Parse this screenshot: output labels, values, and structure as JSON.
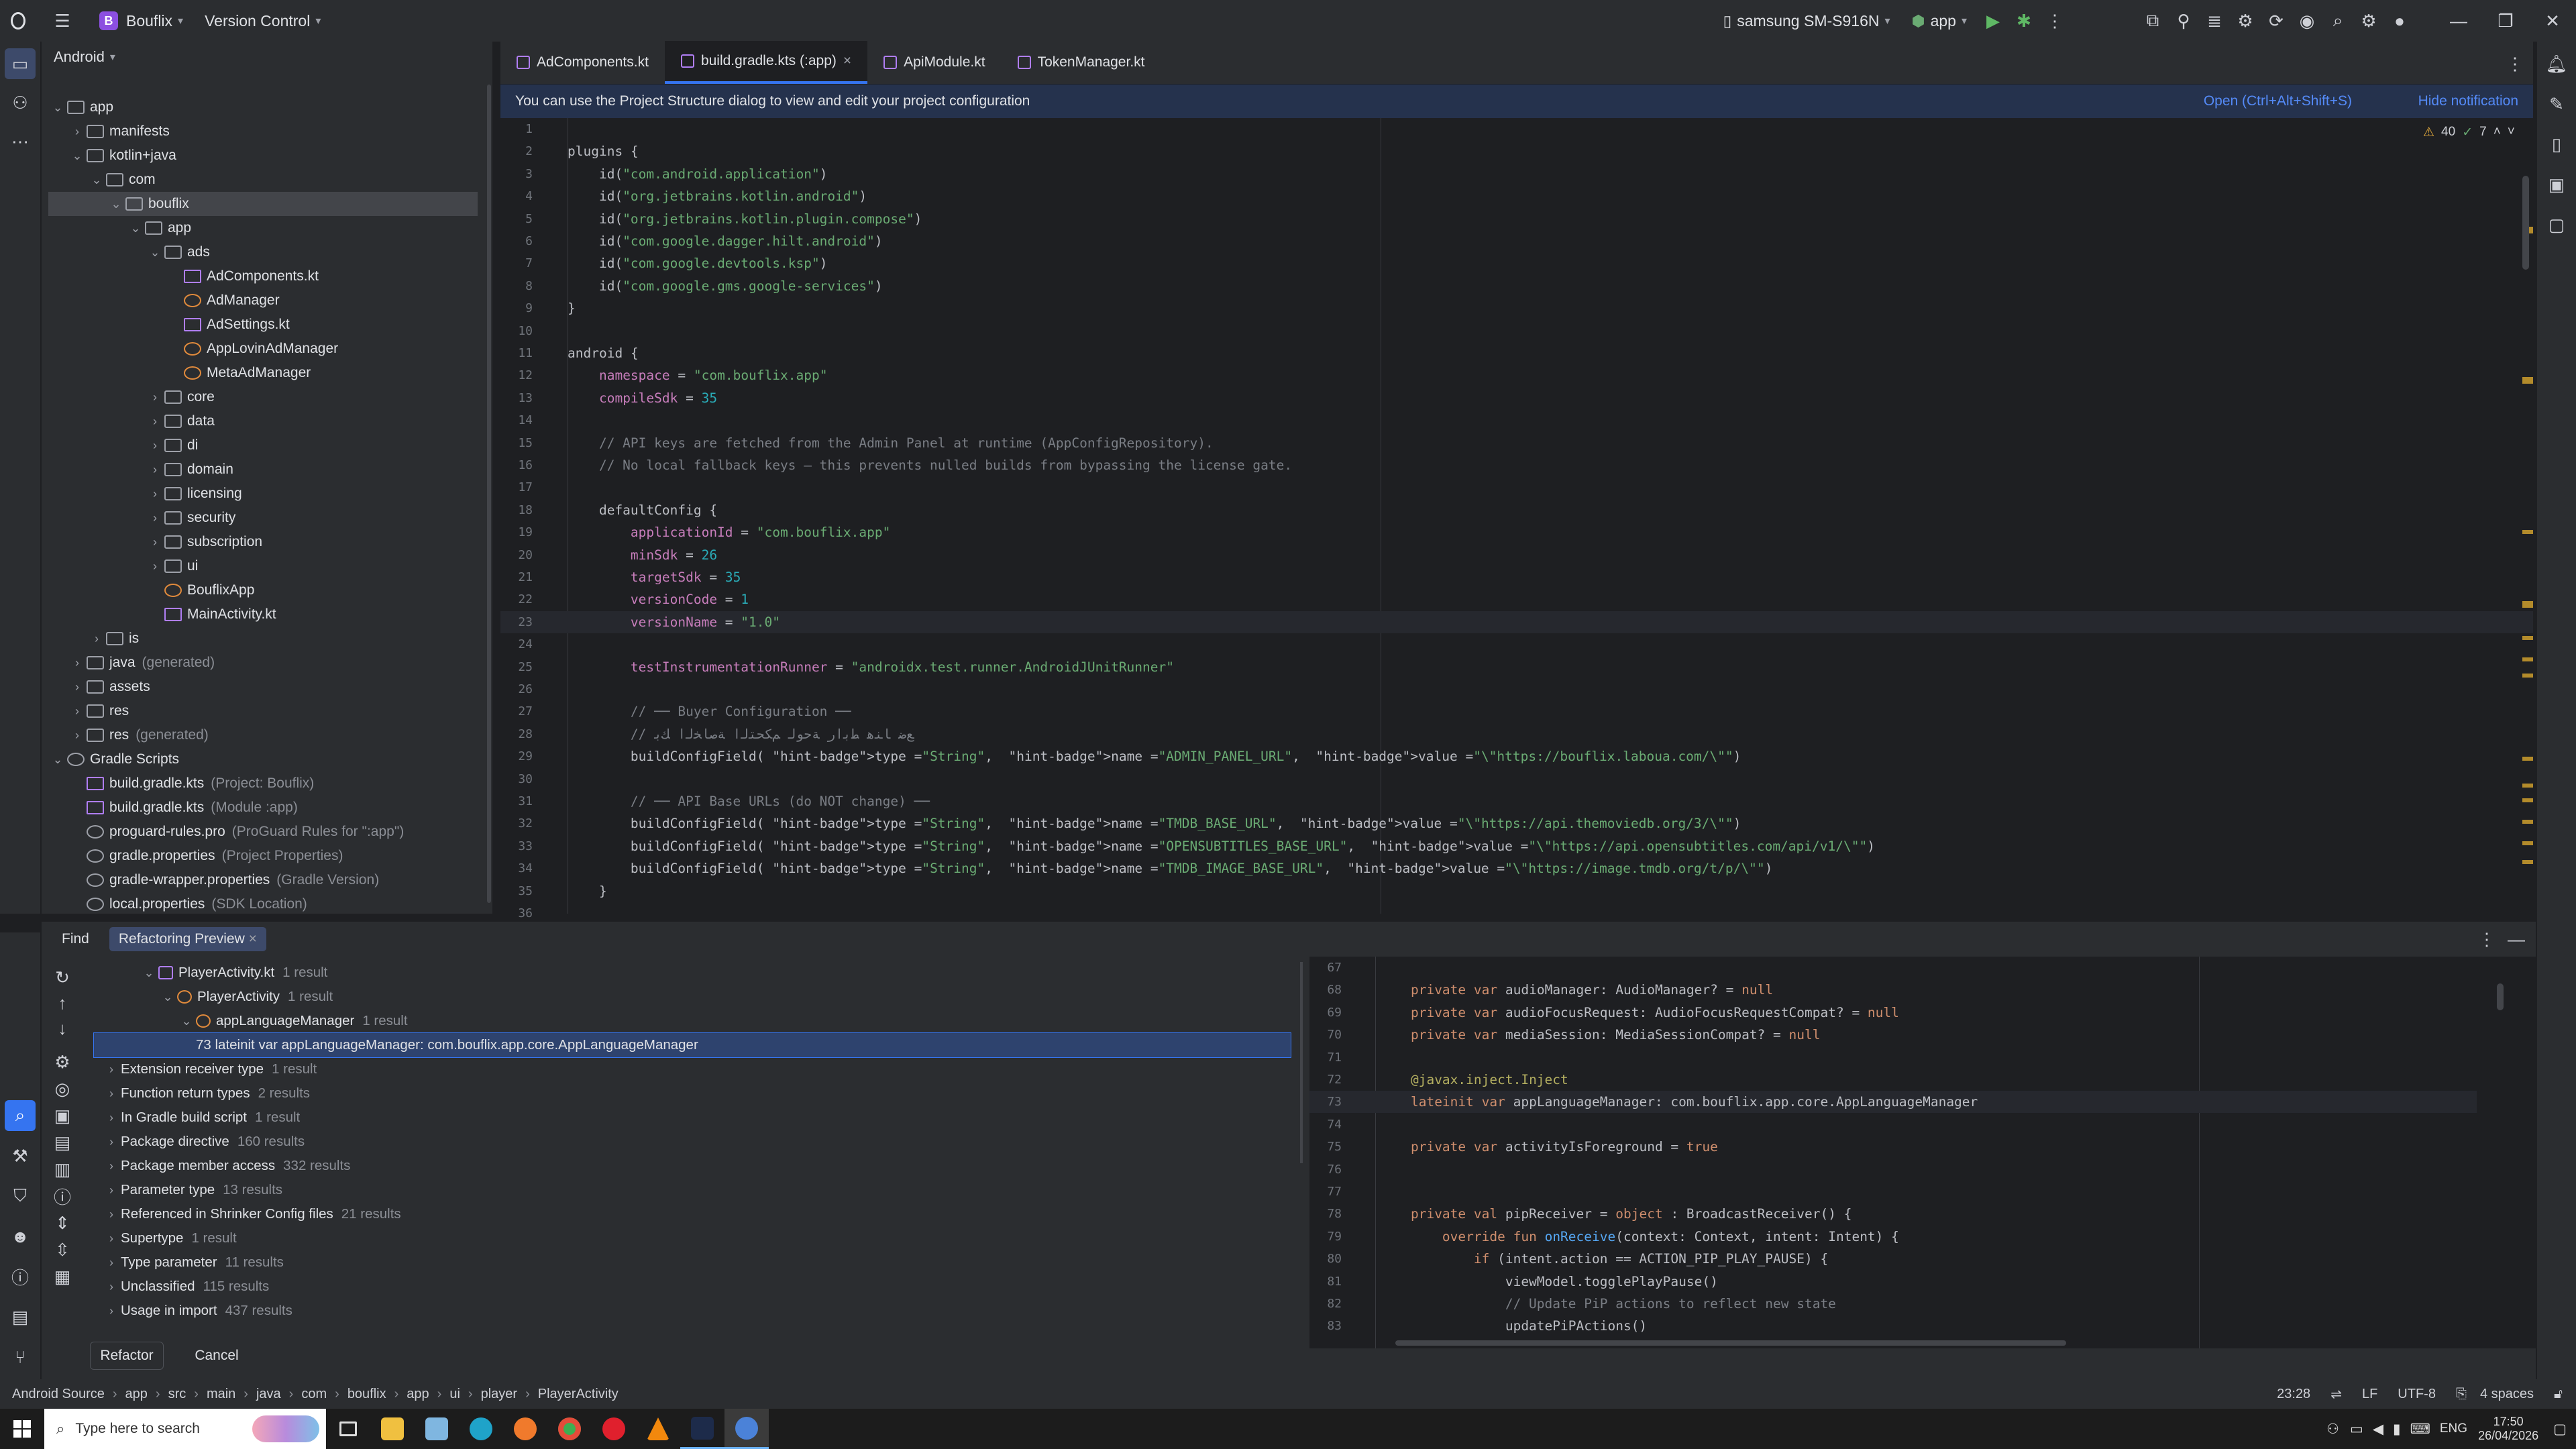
{
  "titlebar": {
    "project_badge": "B",
    "project_name": "Bouflix",
    "vcs_label": "Version Control",
    "device": "samsung SM-S916N",
    "run_config": "app"
  },
  "project_panel": {
    "view_mode": "Android",
    "items": [
      {
        "label": "app",
        "indent": 0,
        "arrow": "⌄",
        "icon": "folder",
        "hint": ""
      },
      {
        "label": "manifests",
        "indent": 1,
        "arrow": "›",
        "icon": "folder",
        "hint": ""
      },
      {
        "label": "kotlin+java",
        "indent": 1,
        "arrow": "⌄",
        "icon": "folder",
        "hint": ""
      },
      {
        "label": "com",
        "indent": 2,
        "arrow": "⌄",
        "icon": "folder",
        "hint": ""
      },
      {
        "label": "bouflix",
        "indent": 3,
        "arrow": "⌄",
        "icon": "folder",
        "hint": "",
        "selected": true
      },
      {
        "label": "app",
        "indent": 4,
        "arrow": "⌄",
        "icon": "folder",
        "hint": ""
      },
      {
        "label": "ads",
        "indent": 5,
        "arrow": "⌄",
        "icon": "folder",
        "hint": ""
      },
      {
        "label": "AdComponents.kt",
        "indent": 6,
        "arrow": "",
        "icon": "kt",
        "hint": ""
      },
      {
        "label": "AdManager",
        "indent": 6,
        "arrow": "",
        "icon": "cls",
        "hint": ""
      },
      {
        "label": "AdSettings.kt",
        "indent": 6,
        "arrow": "",
        "icon": "kt",
        "hint": ""
      },
      {
        "label": "AppLovinAdManager",
        "indent": 6,
        "arrow": "",
        "icon": "cls",
        "hint": ""
      },
      {
        "label": "MetaAdManager",
        "indent": 6,
        "arrow": "",
        "icon": "cls",
        "hint": ""
      },
      {
        "label": "core",
        "indent": 5,
        "arrow": "›",
        "icon": "folder",
        "hint": ""
      },
      {
        "label": "data",
        "indent": 5,
        "arrow": "›",
        "icon": "folder",
        "hint": ""
      },
      {
        "label": "di",
        "indent": 5,
        "arrow": "›",
        "icon": "folder",
        "hint": ""
      },
      {
        "label": "domain",
        "indent": 5,
        "arrow": "›",
        "icon": "folder",
        "hint": ""
      },
      {
        "label": "licensing",
        "indent": 5,
        "arrow": "›",
        "icon": "folder",
        "hint": ""
      },
      {
        "label": "security",
        "indent": 5,
        "arrow": "›",
        "icon": "folder",
        "hint": ""
      },
      {
        "label": "subscription",
        "indent": 5,
        "arrow": "›",
        "icon": "folder",
        "hint": ""
      },
      {
        "label": "ui",
        "indent": 5,
        "arrow": "›",
        "icon": "folder",
        "hint": ""
      },
      {
        "label": "BouflixApp",
        "indent": 5,
        "arrow": "",
        "icon": "cls",
        "hint": ""
      },
      {
        "label": "MainActivity.kt",
        "indent": 5,
        "arrow": "",
        "icon": "kt",
        "hint": ""
      },
      {
        "label": "is",
        "indent": 2,
        "arrow": "›",
        "icon": "folder",
        "hint": ""
      },
      {
        "label": "java",
        "indent": 1,
        "arrow": "›",
        "icon": "folder",
        "hint": "(generated)"
      },
      {
        "label": "assets",
        "indent": 1,
        "arrow": "›",
        "icon": "folder",
        "hint": ""
      },
      {
        "label": "res",
        "indent": 1,
        "arrow": "›",
        "icon": "folder",
        "hint": ""
      },
      {
        "label": "res",
        "indent": 1,
        "arrow": "›",
        "icon": "folder",
        "hint": "(generated)"
      },
      {
        "label": "Gradle Scripts",
        "indent": 0,
        "arrow": "⌄",
        "icon": "gr",
        "hint": ""
      },
      {
        "label": "build.gradle.kts",
        "indent": 1,
        "arrow": "",
        "icon": "kt",
        "hint": "(Project: Bouflix)"
      },
      {
        "label": "build.gradle.kts",
        "indent": 1,
        "arrow": "",
        "icon": "kt",
        "hint": "(Module :app)"
      },
      {
        "label": "proguard-rules.pro",
        "indent": 1,
        "arrow": "",
        "icon": "gr",
        "hint": "(ProGuard Rules for \":app\")"
      },
      {
        "label": "gradle.properties",
        "indent": 1,
        "arrow": "",
        "icon": "gr",
        "hint": "(Project Properties)"
      },
      {
        "label": "gradle-wrapper.properties",
        "indent": 1,
        "arrow": "",
        "icon": "gr",
        "hint": "(Gradle Version)"
      },
      {
        "label": "local.properties",
        "indent": 1,
        "arrow": "",
        "icon": "gr",
        "hint": "(SDK Location)"
      }
    ]
  },
  "editor": {
    "tabs": [
      {
        "label": "AdComponents.kt",
        "active": false
      },
      {
        "label": "build.gradle.kts (:app)",
        "active": true
      },
      {
        "label": "ApiModule.kt",
        "active": false
      },
      {
        "label": "TokenManager.kt",
        "active": false
      }
    ],
    "notification": {
      "text": "You can use the Project Structure dialog to view and edit your project configuration",
      "open_link": "Open (Ctrl+Alt+Shift+S)",
      "hide_link": "Hide notification"
    },
    "warnings": "40",
    "weak_warnings": "7",
    "current_line": 23,
    "lines": [
      "",
      "plugins {",
      "    id(\"com.android.application\")",
      "    id(\"org.jetbrains.kotlin.android\")",
      "    id(\"org.jetbrains.kotlin.plugin.compose\")",
      "    id(\"com.google.dagger.hilt.android\")",
      "    id(\"com.google.devtools.ksp\")",
      "    id(\"com.google.gms.google-services\")",
      "}",
      "",
      "android {",
      "    namespace = \"com.bouflix.app\"",
      "    compileSdk = 35",
      "",
      "    // API keys are fetched from the Admin Panel at runtime (AppConfigRepository).",
      "    // No local fallback keys — this prevents nulled builds from bypassing the license gate.",
      "",
      "    defaultConfig {",
      "        applicationId = \"com.bouflix.app\"",
      "        minSdk = 26",
      "        targetSdk = 35",
      "        versionCode = 1",
      "        versionName = \"1.0\"",
      "",
      "        testInstrumentationRunner = \"androidx.test.runner.AndroidJUnitRunner\"",
      "",
      "        // ── Buyer Configuration ──",
      "        // ﻊﺿ ﺎﻨﻫ ﻂﺑاﺭ ﺔﺣﻮﻟ ﻢﻜﺤﺘﻟا ﺔﺻﺎﺨﻟا ﻚﺑ",
      "        buildConfigField( type = \"String\",  name = \"ADMIN_PANEL_URL\",  value = \"\\\"https://bouflix.laboua.com/\\\"\")",
      "",
      "        // ── API Base URLs (do NOT change) ──",
      "        buildConfigField( type = \"String\",  name = \"TMDB_BASE_URL\",  value = \"\\\"https://api.themoviedb.org/3/\\\"\")",
      "        buildConfigField( type = \"String\",  name = \"OPENSUBTITLES_BASE_URL\",  value = \"\\\"https://api.opensubtitles.com/api/v1/\\\"\")",
      "        buildConfigField( type = \"String\",  name = \"TMDB_IMAGE_BASE_URL\",  value = \"\\\"https://image.tmdb.org/t/p/\\\"\")",
      "    }",
      ""
    ]
  },
  "find": {
    "tabs": [
      {
        "label": "Find",
        "active": false
      },
      {
        "label": "Refactoring Preview",
        "active": true
      }
    ],
    "results": [
      {
        "label": "PlayerActivity.kt",
        "count": "1 result",
        "indent": 2,
        "arrow": "⌄"
      },
      {
        "label": "PlayerActivity",
        "count": "1 result",
        "indent": 3,
        "arrow": "⌄"
      },
      {
        "label": "appLanguageManager",
        "count": "1 result",
        "indent": 4,
        "arrow": "⌄"
      },
      {
        "label": "73 lateinit var appLanguageManager: com.bouflix.app.core.AppLanguageManager",
        "count": "",
        "indent": 5,
        "arrow": "",
        "selected": true
      },
      {
        "label": "Extension receiver type",
        "count": "1 result",
        "indent": 0,
        "arrow": "›"
      },
      {
        "label": "Function return types",
        "count": "2 results",
        "indent": 0,
        "arrow": "›"
      },
      {
        "label": "In Gradle build script",
        "count": "1 result",
        "indent": 0,
        "arrow": "›"
      },
      {
        "label": "Package directive",
        "count": "160 results",
        "indent": 0,
        "arrow": "›"
      },
      {
        "label": "Package member access",
        "count": "332 results",
        "indent": 0,
        "arrow": "›"
      },
      {
        "label": "Parameter type",
        "count": "13 results",
        "indent": 0,
        "arrow": "›"
      },
      {
        "label": "Referenced in Shrinker Config files",
        "count": "21 results",
        "indent": 0,
        "arrow": "›"
      },
      {
        "label": "Supertype",
        "count": "1 result",
        "indent": 0,
        "arrow": "›"
      },
      {
        "label": "Type parameter",
        "count": "11 results",
        "indent": 0,
        "arrow": "›"
      },
      {
        "label": "Unclassified",
        "count": "115 results",
        "indent": 0,
        "arrow": "›"
      },
      {
        "label": "Usage in import",
        "count": "437 results",
        "indent": 0,
        "arrow": "›"
      }
    ],
    "preview_start": 67,
    "preview_current": 73,
    "preview_lines": [
      "",
      "    private var audioManager: AudioManager? = null",
      "    private var audioFocusRequest: AudioFocusRequestCompat? = null",
      "    private var mediaSession: MediaSessionCompat? = null",
      "",
      "    @javax.inject.Inject",
      "    lateinit var appLanguageManager: com.bouflix.app.core.AppLanguageManager",
      "",
      "    private var activityIsForeground = true",
      "",
      "",
      "    private val pipReceiver = object : BroadcastReceiver() {",
      "        override fun onReceive(context: Context, intent: Intent) {",
      "            if (intent.action == ACTION_PIP_PLAY_PAUSE) {",
      "                viewModel.togglePlayPause()",
      "                // Update PiP actions to reflect new state",
      "                updatePiPActions()"
    ],
    "refactor_label": "Refactor",
    "cancel_label": "Cancel"
  },
  "statusbar": {
    "breadcrumb": [
      "Android Source",
      "app",
      "src",
      "main",
      "java",
      "com",
      "bouflix",
      "app",
      "ui",
      "player",
      "PlayerActivity"
    ],
    "position": "23:28",
    "line_sep": "LF",
    "encoding": "UTF-8",
    "indent": "4 spaces"
  },
  "taskbar": {
    "search_placeholder": "Type here to search",
    "lang": "ENG",
    "time": "17:50",
    "date": "26/04/2026"
  }
}
